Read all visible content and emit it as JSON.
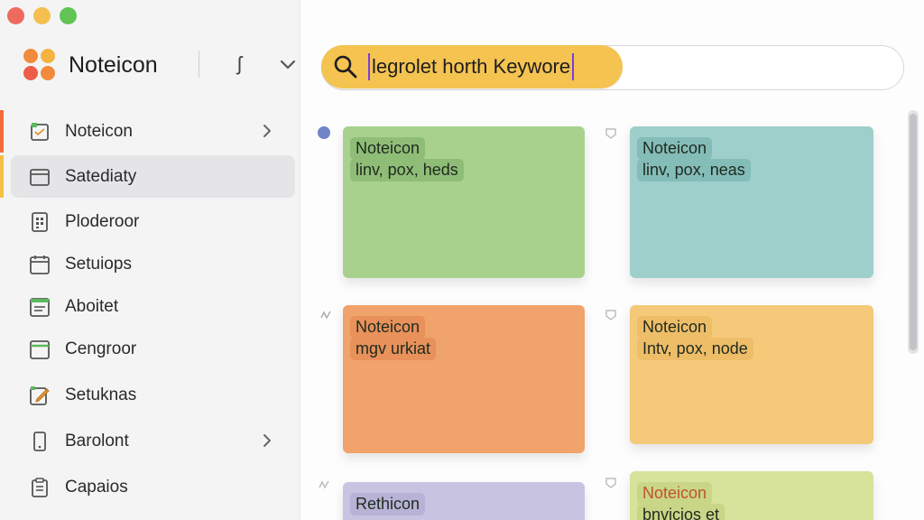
{
  "window": {
    "controls": [
      "close",
      "minimize",
      "maximize"
    ]
  },
  "sidebar": {
    "brand": {
      "name": "Noteicon",
      "sync_glyph": "ʃ",
      "logo_icon": "logo-icon"
    },
    "items": [
      {
        "label": "Noteicon",
        "icon": "note-icon",
        "has_chevron": true,
        "accent": "#f26b3a",
        "active": false
      },
      {
        "label": "Satediaty",
        "icon": "folder-icon",
        "has_chevron": false,
        "accent": "#f5c043",
        "active": true
      },
      {
        "label": "Ploderoor",
        "icon": "document-grid-icon",
        "has_chevron": false,
        "active": false
      },
      {
        "label": "Setuiops",
        "icon": "calendar-icon",
        "has_chevron": false,
        "active": false
      },
      {
        "label": "Aboitet",
        "icon": "list-icon",
        "has_chevron": false,
        "active": false
      },
      {
        "label": "Cengroor",
        "icon": "calendar-icon",
        "has_chevron": false,
        "active": false
      },
      {
        "label": "Setuknas",
        "icon": "edit-icon",
        "has_chevron": false,
        "active": false
      },
      {
        "label": "Barolont",
        "icon": "phone-icon",
        "has_chevron": true,
        "active": false
      },
      {
        "label": "Capaios",
        "icon": "clipboard-icon",
        "has_chevron": false,
        "active": false
      }
    ]
  },
  "search": {
    "value": "legrolet horth Keywore",
    "accent_color": "#f4c350"
  },
  "notes": [
    {
      "title": "Noteicon",
      "subtitle": "linv, pox, heds",
      "color": "#a9d18e",
      "highlight": "#8fbd77"
    },
    {
      "title": "Noteicon",
      "subtitle": "linv, pox, neas",
      "color": "#9ecfcb",
      "highlight": "#84bcb8"
    },
    {
      "title": "Noteicon",
      "subtitle": "mgv urkiat",
      "color": "#f0a36a",
      "highlight": "#e8915a"
    },
    {
      "title": "Noteicon",
      "subtitle": "Intv, pox, node",
      "color": "#f5c97a",
      "highlight": "#eebd68"
    },
    {
      "title": "Rethicon",
      "subtitle": "",
      "color": "#c8c3e0",
      "highlight": "#b8b2d6"
    },
    {
      "title": "Noteicon",
      "subtitle": "bnvicios et",
      "color": "#d7e29a",
      "highlight": "#c9d687",
      "title_color": "#c0522b"
    }
  ]
}
